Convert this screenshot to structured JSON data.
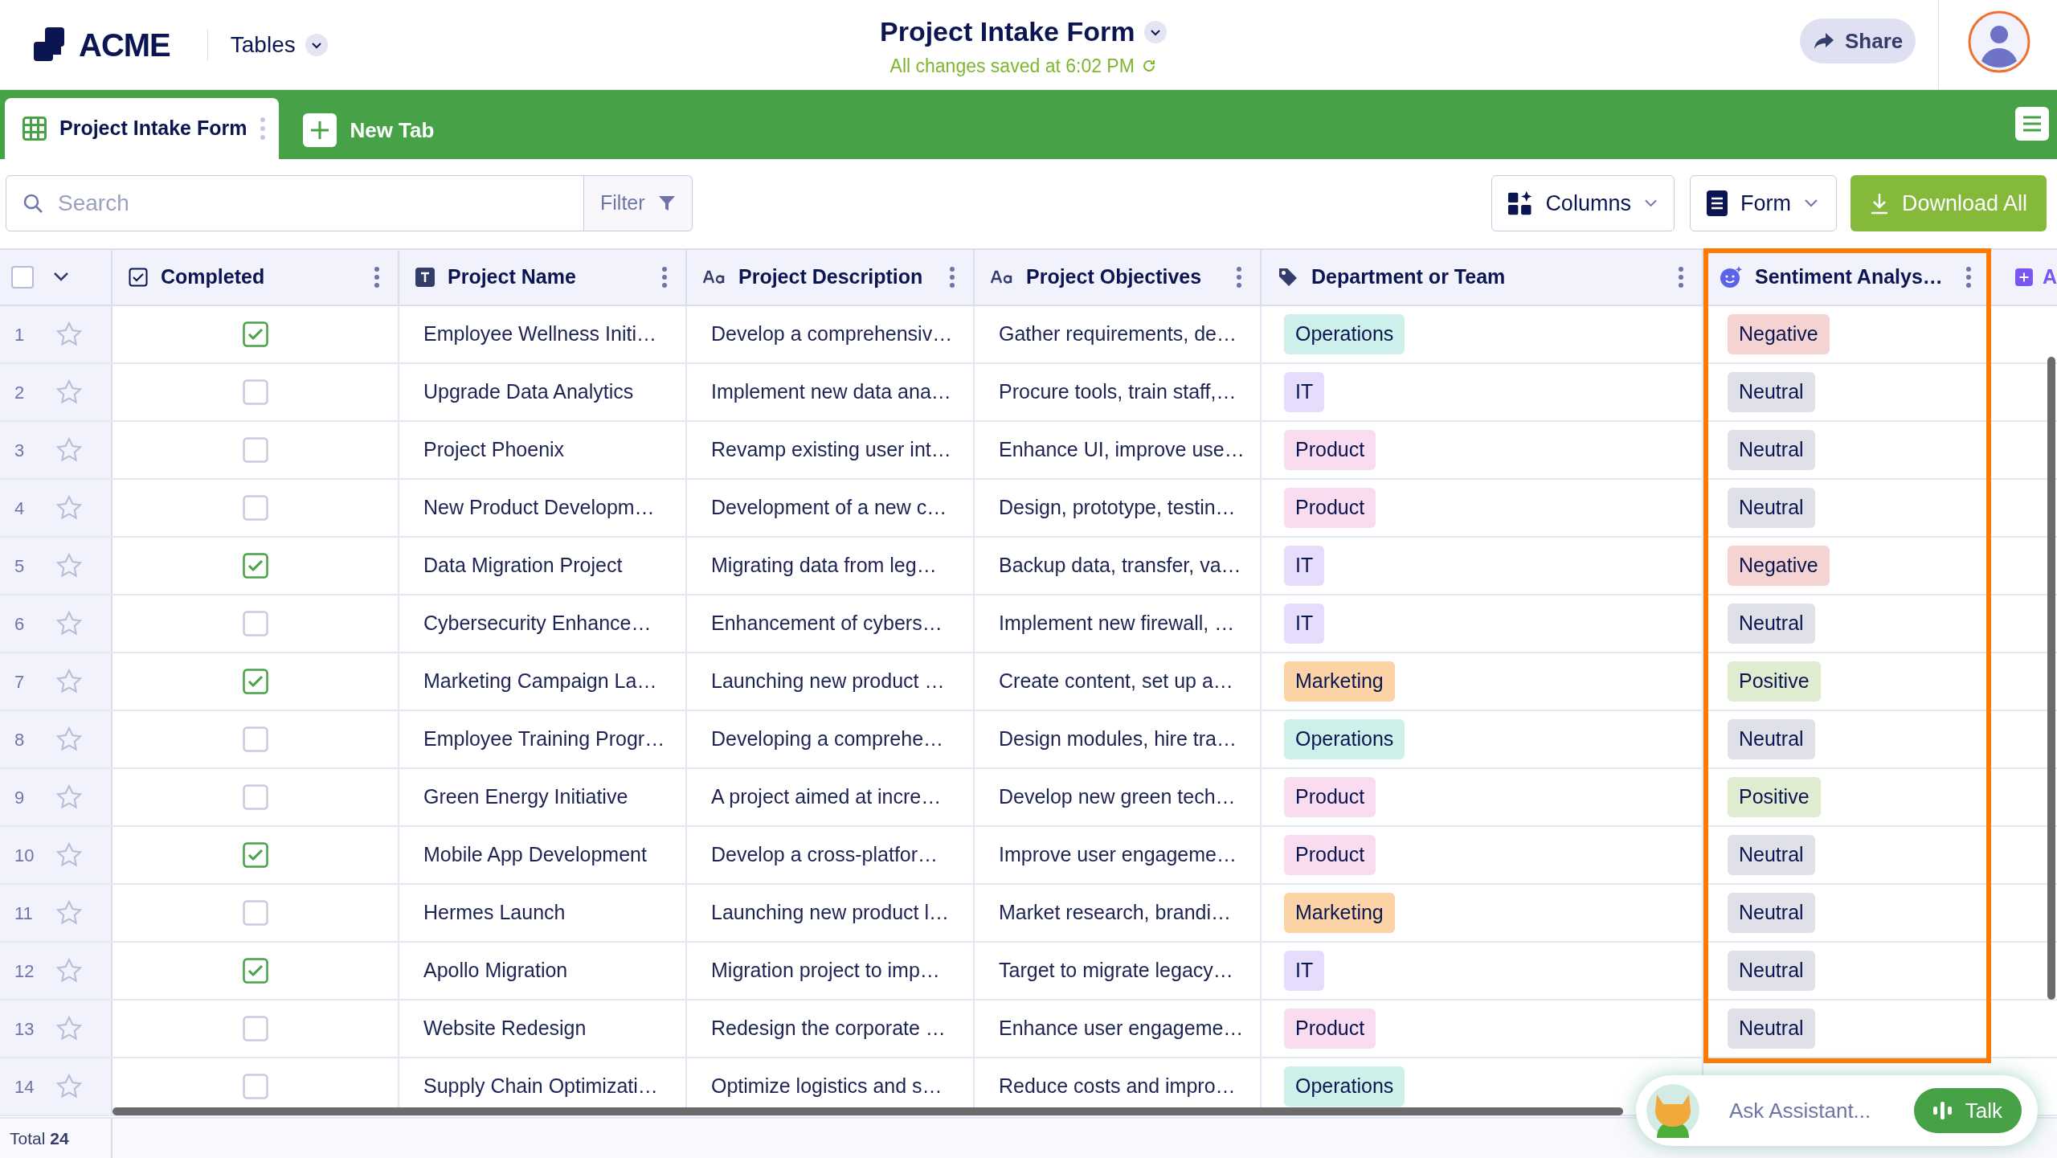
{
  "header": {
    "logo": "ACME",
    "section": "Tables",
    "title": "Project Intake Form",
    "saved": "All changes saved at 6:02 PM",
    "share": "Share"
  },
  "tabs": [
    {
      "label": "Project Intake Form",
      "selected": true
    },
    {
      "label": "New Tab",
      "selected": false,
      "kind": "add"
    }
  ],
  "toolbar": {
    "search_placeholder": "Search",
    "filter": "Filter",
    "columns": "Columns",
    "form": "Form",
    "download": "Download All"
  },
  "columns": [
    {
      "label": "Completed",
      "kind": "check",
      "highlighted": false
    },
    {
      "label": "Project Name",
      "kind": "text",
      "highlighted": false
    },
    {
      "label": "Project Description",
      "kind": "longtext",
      "highlighted": false
    },
    {
      "label": "Project Objectives",
      "kind": "longtext",
      "highlighted": false
    },
    {
      "label": "Department or Team",
      "kind": "tag",
      "highlighted": false
    },
    {
      "label": "Sentiment Analys…",
      "kind": "ai",
      "highlighted": true
    }
  ],
  "add_column": "A",
  "select_all_checked": false,
  "rows": [
    {
      "num": "1",
      "starred": false,
      "completed": true,
      "name": "Employee Wellness Initi…",
      "description": "Develop a comprehensiv…",
      "objectives": "Gather requirements, de…",
      "department": {
        "label": "Operations",
        "color": "#cdf0ea"
      },
      "sentiment": {
        "label": "Negative",
        "color": "#f6d3d3"
      }
    },
    {
      "num": "2",
      "starred": false,
      "completed": false,
      "name": "Upgrade Data Analytics",
      "description": "Implement new data ana…",
      "objectives": "Procure tools, train staff,…",
      "department": {
        "label": "IT",
        "color": "#e6dcfb"
      },
      "sentiment": {
        "label": "Neutral",
        "color": "#dfe0e8"
      }
    },
    {
      "num": "3",
      "starred": false,
      "completed": false,
      "name": "Project Phoenix",
      "description": "Revamp existing user int…",
      "objectives": "Enhance UI, improve use…",
      "department": {
        "label": "Product",
        "color": "#f9dcef"
      },
      "sentiment": {
        "label": "Neutral",
        "color": "#dfe0e8"
      }
    },
    {
      "num": "4",
      "starred": false,
      "completed": false,
      "name": "New Product Developm…",
      "description": "Development of a new c…",
      "objectives": "Design, prototype, testin…",
      "department": {
        "label": "Product",
        "color": "#f9dcef"
      },
      "sentiment": {
        "label": "Neutral",
        "color": "#dfe0e8"
      }
    },
    {
      "num": "5",
      "starred": false,
      "completed": true,
      "name": "Data Migration Project",
      "description": "Migrating data from leg…",
      "objectives": "Backup data, transfer, va…",
      "department": {
        "label": "IT",
        "color": "#e6dcfb"
      },
      "sentiment": {
        "label": "Negative",
        "color": "#f6d3d3"
      }
    },
    {
      "num": "6",
      "starred": false,
      "completed": false,
      "name": "Cybersecurity Enhance…",
      "description": "Enhancement of cybers…",
      "objectives": "Implement new firewall, …",
      "department": {
        "label": "IT",
        "color": "#e6dcfb"
      },
      "sentiment": {
        "label": "Neutral",
        "color": "#dfe0e8"
      }
    },
    {
      "num": "7",
      "starred": false,
      "completed": true,
      "name": "Marketing Campaign La…",
      "description": "Launching new product …",
      "objectives": "Create content, set up a…",
      "department": {
        "label": "Marketing",
        "color": "#fbd3a6"
      },
      "sentiment": {
        "label": "Positive",
        "color": "#e0ecd0"
      }
    },
    {
      "num": "8",
      "starred": false,
      "completed": false,
      "name": "Employee Training Progr…",
      "description": "Developing a comprehe…",
      "objectives": "Design modules, hire tra…",
      "department": {
        "label": "Operations",
        "color": "#cdf0ea"
      },
      "sentiment": {
        "label": "Neutral",
        "color": "#dfe0e8"
      }
    },
    {
      "num": "9",
      "starred": false,
      "completed": false,
      "name": "Green Energy Initiative",
      "description": "A project aimed at incre…",
      "objectives": "Develop new green tech…",
      "department": {
        "label": "Product",
        "color": "#f9dcef"
      },
      "sentiment": {
        "label": "Positive",
        "color": "#e0ecd0"
      }
    },
    {
      "num": "10",
      "starred": false,
      "completed": true,
      "name": "Mobile App Development",
      "description": "Develop a cross-platfor…",
      "objectives": "Improve user engageme…",
      "department": {
        "label": "Product",
        "color": "#f9dcef"
      },
      "sentiment": {
        "label": "Neutral",
        "color": "#dfe0e8"
      }
    },
    {
      "num": "11",
      "starred": false,
      "completed": false,
      "name": "Hermes Launch",
      "description": "Launching new product l…",
      "objectives": "Market research, brandi…",
      "department": {
        "label": "Marketing",
        "color": "#fbd3a6"
      },
      "sentiment": {
        "label": "Neutral",
        "color": "#dfe0e8"
      }
    },
    {
      "num": "12",
      "starred": false,
      "completed": true,
      "name": "Apollo Migration",
      "description": "Migration project to imp…",
      "objectives": "Target to migrate legacy…",
      "department": {
        "label": "IT",
        "color": "#e6dcfb"
      },
      "sentiment": {
        "label": "Neutral",
        "color": "#dfe0e8"
      }
    },
    {
      "num": "13",
      "starred": false,
      "completed": false,
      "name": "Website Redesign",
      "description": "Redesign the corporate …",
      "objectives": "Enhance user engageme…",
      "department": {
        "label": "Product",
        "color": "#f9dcef"
      },
      "sentiment": {
        "label": "Neutral",
        "color": "#dfe0e8"
      }
    },
    {
      "num": "14",
      "starred": false,
      "completed": false,
      "name": "Supply Chain Optimizati…",
      "description": "Optimize logistics and s…",
      "objectives": "Reduce costs and impro…",
      "department": {
        "label": "Operations",
        "color": "#cdf0ea"
      },
      "sentiment": null
    }
  ],
  "footer": {
    "label": "Total",
    "count": "24"
  },
  "assistant": {
    "placeholder": "Ask Assistant...",
    "button": "Talk"
  }
}
